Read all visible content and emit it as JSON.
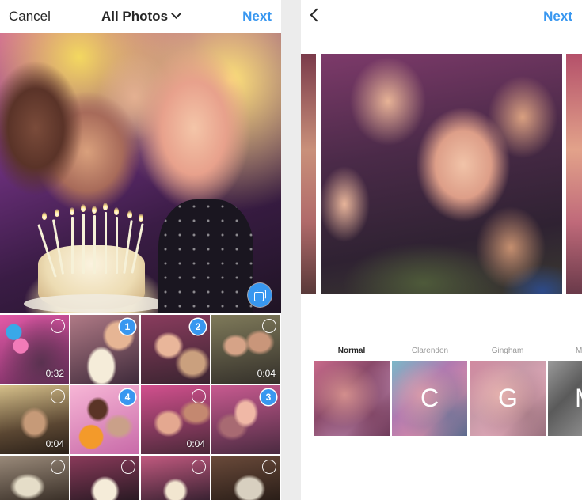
{
  "left_screen": {
    "header": {
      "cancel_label": "Cancel",
      "title": "All Photos",
      "next_label": "Next"
    },
    "grid": {
      "cells": [
        {
          "duration": "0:32",
          "selected_number": ""
        },
        {
          "duration": "",
          "selected_number": "1"
        },
        {
          "duration": "",
          "selected_number": "2"
        },
        {
          "duration": "0:04",
          "selected_number": ""
        },
        {
          "duration": "0:04",
          "selected_number": ""
        },
        {
          "duration": "",
          "selected_number": "4"
        },
        {
          "duration": "0:04",
          "selected_number": ""
        },
        {
          "duration": "",
          "selected_number": "3"
        },
        {
          "duration": "",
          "selected_number": ""
        },
        {
          "duration": "",
          "selected_number": ""
        },
        {
          "duration": "",
          "selected_number": ""
        },
        {
          "duration": "",
          "selected_number": ""
        }
      ]
    },
    "icons": {
      "multi_select": "layers-icon",
      "dropdown": "chevron-down-icon"
    },
    "accent_color": "#3897f0"
  },
  "right_screen": {
    "header": {
      "next_label": "Next"
    },
    "icons": {
      "back": "chevron-left-icon"
    },
    "filters": [
      {
        "name": "Normal",
        "letter": "",
        "active": true
      },
      {
        "name": "Clarendon",
        "letter": "C",
        "active": false
      },
      {
        "name": "Gingham",
        "letter": "G",
        "active": false
      },
      {
        "name": "M",
        "letter": "M",
        "active": false
      }
    ]
  }
}
